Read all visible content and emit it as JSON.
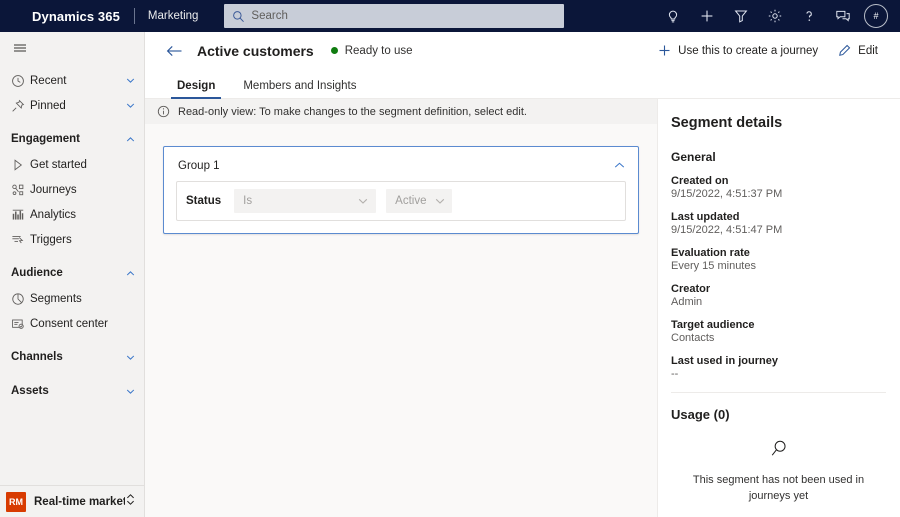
{
  "topbar": {
    "brand": "Dynamics 365",
    "app_name": "Marketing",
    "search": {
      "placeholder": "Search",
      "value": "",
      "icon": "search-icon"
    },
    "actions": [
      {
        "name": "ideas-lightbulb-icon",
        "label": "Ideas"
      },
      {
        "name": "quick-create-plus-icon",
        "label": "Quick create"
      },
      {
        "name": "filter-icon",
        "label": "Filter"
      },
      {
        "name": "settings-gear-icon",
        "label": "Settings"
      },
      {
        "name": "help-question-icon",
        "label": "Help"
      },
      {
        "name": "feedback-chat-icon",
        "label": "Feedback"
      }
    ],
    "avatar_initials": "#",
    "background": "#0b1639"
  },
  "sidebar": {
    "hamburger_label": "Show/Hide navigation",
    "items": [
      {
        "label": "Recent",
        "icon": "clock-icon",
        "type": "expandable",
        "expanded": false
      },
      {
        "label": "Pinned",
        "icon": "pin-icon",
        "type": "expandable",
        "expanded": false
      }
    ],
    "groups": [
      {
        "label": "Engagement",
        "expanded": true,
        "items": [
          {
            "label": "Get started",
            "icon": "play-triangle-icon"
          },
          {
            "label": "Journeys",
            "icon": "journeys-icon"
          },
          {
            "label": "Analytics",
            "icon": "analytics-icon"
          },
          {
            "label": "Triggers",
            "icon": "triggers-icon"
          }
        ]
      },
      {
        "label": "Audience",
        "expanded": true,
        "items": [
          {
            "label": "Segments",
            "icon": "segments-pie-icon"
          },
          {
            "label": "Consent center",
            "icon": "consent-center-icon"
          }
        ]
      },
      {
        "label": "Channels",
        "expanded": false,
        "items": []
      },
      {
        "label": "Assets",
        "expanded": false,
        "items": []
      }
    ],
    "workspace": {
      "badge": "RM",
      "badge_color": "#d83b01",
      "label": "Real-time marketi...",
      "icon": "updown-chevron-icon"
    }
  },
  "command_bar": {
    "back_icon": "back-arrow-icon",
    "title": "Active customers",
    "status": {
      "text": "Ready to use",
      "color": "#107c10"
    },
    "actions": [
      {
        "label": "Use this to create a journey",
        "icon": "plus-icon"
      },
      {
        "label": "Edit",
        "icon": "pencil-edit-icon"
      }
    ]
  },
  "tabs": [
    {
      "label": "Design",
      "active": true
    },
    {
      "label": "Members and Insights",
      "active": false
    }
  ],
  "info_bar": {
    "icon": "info-circle-icon",
    "message": "Read-only view: To make changes to the segment definition, select edit."
  },
  "canvas": {
    "group": {
      "title": "Group 1",
      "collapse_icon": "chevron-up-icon",
      "rule": {
        "attribute": "Status",
        "operator": {
          "value": "Is",
          "chevron": "chevron-down-icon",
          "disabled": true
        },
        "value": {
          "value": "Active",
          "chevron": "chevron-down-icon",
          "disabled": true
        }
      }
    }
  },
  "details_panel": {
    "title": "Segment details",
    "general_heading": "General",
    "fields": [
      {
        "label": "Created on",
        "value": "9/15/2022, 4:51:37 PM"
      },
      {
        "label": "Last updated",
        "value": "9/15/2022, 4:51:47 PM"
      },
      {
        "label": "Evaluation rate",
        "value": "Every 15 minutes"
      },
      {
        "label": "Creator",
        "value": "Admin"
      },
      {
        "label": "Target audience",
        "value": "Contacts"
      },
      {
        "label": "Last used in journey",
        "value": "--"
      }
    ],
    "usage": {
      "heading": "Usage (0)",
      "empty_icon": "magnifier-icon",
      "empty_text": "This segment has not been used in journeys yet"
    }
  }
}
